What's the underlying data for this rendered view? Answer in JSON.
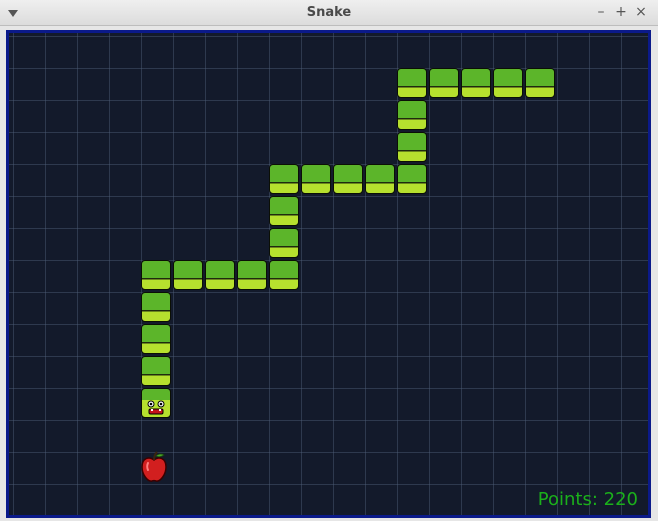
{
  "window": {
    "title": "Snake",
    "controls": {
      "minimize_icon": "–",
      "maximize_icon": "+",
      "close_icon": "×"
    }
  },
  "game": {
    "points_text": "Points: 220",
    "direction": "down",
    "board_color": "#131a2b",
    "border_color": "#0b1a8a",
    "snake_color": "#5cb52a",
    "snake_highlight": "#b6e02e",
    "apple_color": "#d21f1f",
    "score_color": "#1bb01b"
  }
}
